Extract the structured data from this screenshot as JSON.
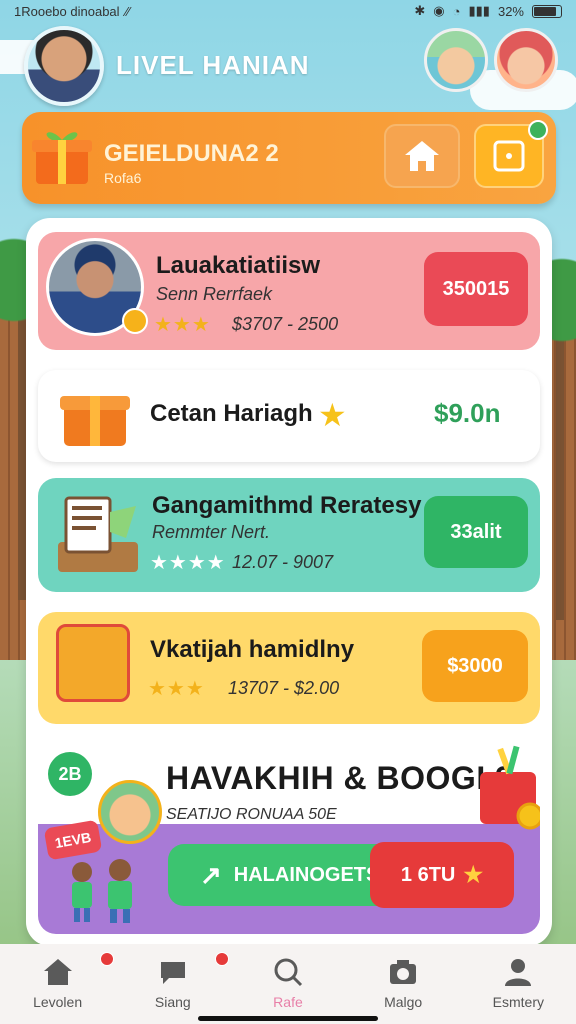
{
  "status_bar": {
    "left_text": "1Rooebo dinoabal",
    "battery_text": "32%"
  },
  "header": {
    "title": "LIVEL HANIAN"
  },
  "banner": {
    "title": "GEIELDUNA2 2",
    "subtitle": "Rofa6"
  },
  "cards": [
    {
      "title": "Lauakatiatiisw",
      "subtitle": "Senn Rerrfaek",
      "stars": "★★★",
      "price_range": "$3707 - 2500",
      "pill": "350015"
    },
    {
      "title": "Cetan Hariagh",
      "price": "$9.0n"
    },
    {
      "title": "Gangamithmd Reratesy",
      "subtitle": "Remmter Nert.",
      "stars": "★★★★",
      "price_range": "12.07 - 9007",
      "pill": "33alit"
    },
    {
      "title": "Vkatijah hamidlny",
      "stars": "★★★",
      "price_range": "13707 - $2.00",
      "pill": "$3000"
    }
  ],
  "promo": {
    "badge": "2B",
    "title": "HAVAKHIH & BOOGI 3",
    "subtitle": "SEATIJO RONUAA 50E",
    "sticker": "1EVB",
    "green_button": "HALAINOGETS",
    "red_button": "1 6TU"
  },
  "bottom_nav": [
    {
      "label": "Levolen",
      "icon": "home-icon",
      "badge": true
    },
    {
      "label": "Siang",
      "icon": "chat-icon",
      "badge": true
    },
    {
      "label": "Rafe",
      "icon": "search-icon",
      "active": true
    },
    {
      "label": "Malgo",
      "icon": "camera-icon"
    },
    {
      "label": "Esmtery",
      "icon": "profile-icon"
    }
  ],
  "colors": {
    "banner": "#f7922a",
    "card_pink": "#f7a6a9",
    "card_teal": "#6fd4bf",
    "card_yellow": "#ffd96a",
    "accent_green": "#2fb565",
    "accent_red": "#ea4a56"
  }
}
